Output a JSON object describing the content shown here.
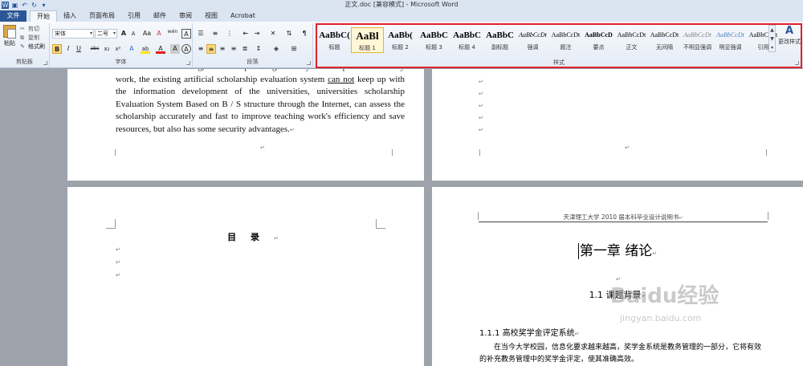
{
  "window": {
    "title": "正文.doc [兼容模式] - Microsoft Word"
  },
  "tabs": [
    "文件",
    "开始",
    "插入",
    "页面布局",
    "引用",
    "邮件",
    "审阅",
    "视图",
    "Acrobat"
  ],
  "clipboard": {
    "paste": "粘贴",
    "cut": "剪切",
    "copy": "复制",
    "format_painter": "格式刷",
    "label": "剪贴板"
  },
  "font": {
    "name": "宋体",
    "size": "二号",
    "label": "字体",
    "grow": "A",
    "shrink": "A",
    "case": "Aa",
    "clear": "A",
    "pinyin": "wén",
    "char_border": "A",
    "bold": "B",
    "italic": "I",
    "underline": "U",
    "strike": "abc",
    "sub": "x₂",
    "sup": "x²",
    "effects": "A",
    "highlight": "ab",
    "color": "A",
    "shade": "A",
    "circle": "A"
  },
  "paragraph": {
    "label": "段落"
  },
  "styles": {
    "label": "样式",
    "items": [
      {
        "sample": "AaBbC(",
        "name": "标题"
      },
      {
        "sample": "AaBl",
        "name": "标题 1"
      },
      {
        "sample": "AaBb(",
        "name": "标题 2"
      },
      {
        "sample": "AaBbC",
        "name": "标题 3"
      },
      {
        "sample": "AaBbC",
        "name": "标题 4"
      },
      {
        "sample": "AaBbC",
        "name": "副标题"
      },
      {
        "sample": "AaBbCcDt",
        "name": "强调"
      },
      {
        "sample": "AaBbCcDt",
        "name": "题注"
      },
      {
        "sample": "AaBbCcD",
        "name": "要点"
      },
      {
        "sample": "AaBbCcDt",
        "name": "正文"
      },
      {
        "sample": "AaBbCcDt",
        "name": "无间隔"
      },
      {
        "sample": "AaBbCcDt",
        "name": "不明显强调"
      },
      {
        "sample": "AaBbCcDt",
        "name": "明显强调"
      },
      {
        "sample": "AaBbCcDt",
        "name": "引用"
      }
    ],
    "change": "更改样式"
  },
  "document": {
    "page1_text_lines": [
      "student has been rising, scholarship management system as part of the daily work, the",
      "existing artificial scholarship evaluation system ",
      "can not",
      " keep up with the information",
      "development of the universities, universities scholarship Evaluation System Based on",
      "B / S structure through the Internet, can assess the scholarship accurately and fast to",
      "improve teaching work's efficiency and save resources, but also has some security",
      "advantages."
    ],
    "toc_title": "目录",
    "header_text": "天津理工大学 2010 届本科毕业设计说明书",
    "chapter_title": "第一章  绪论",
    "section_title": "1.1 课题背景",
    "subsection_title": "1.1.1 高校奖学金评定系统",
    "paragraph": "在当今大学校园，信息化要求越来越高，奖学金系统是教务管理的一部分，它将有效的补充教务管理中的奖学金评定，使其准确高效。",
    "watermark": "Baidu经验",
    "watermark_url": "jingyan.baidu.com",
    "para_mark": "↵"
  }
}
